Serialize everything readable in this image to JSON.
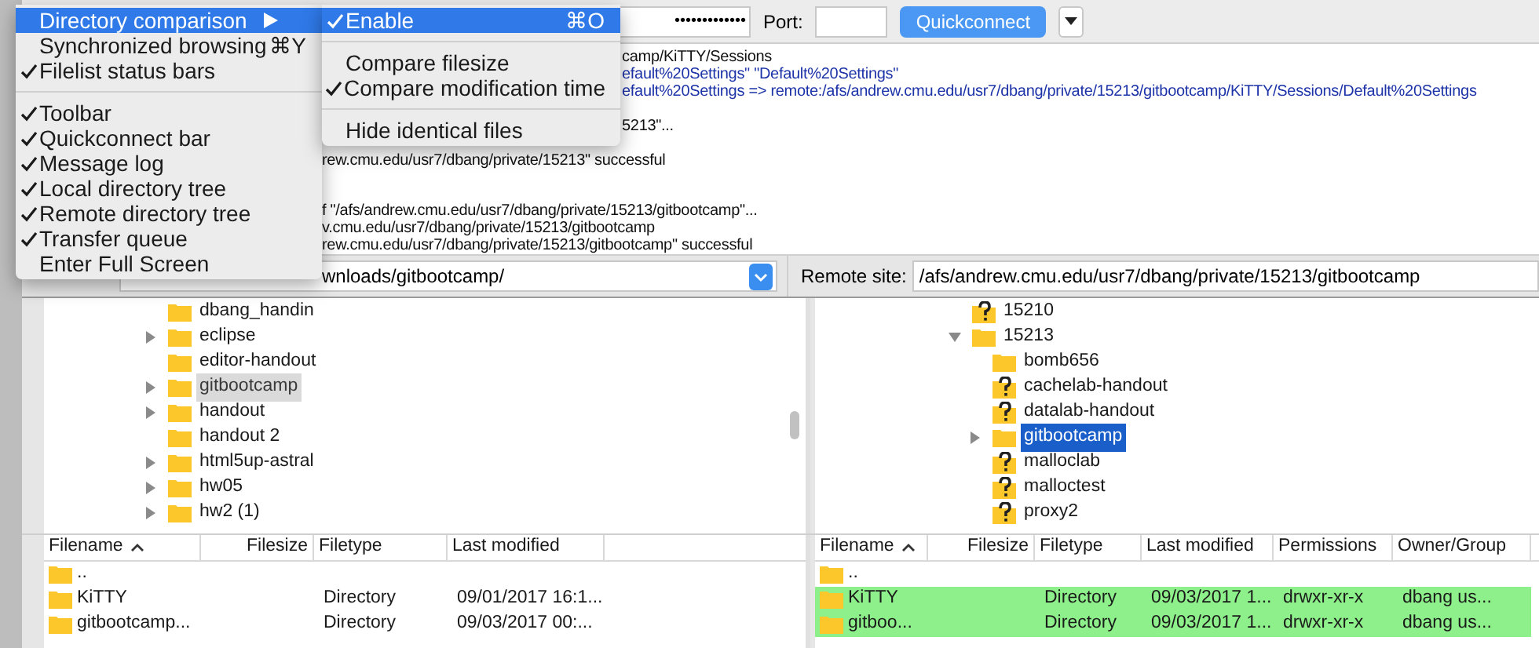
{
  "menu": {
    "items": [
      {
        "kind": "item",
        "label": "Directory comparison",
        "checked": false,
        "selected": true,
        "submenu": true
      },
      {
        "kind": "item",
        "label": "Synchronized browsing",
        "checked": false,
        "selected": false,
        "submenu": false,
        "shortcut": "⌘Y"
      },
      {
        "kind": "item",
        "label": "Filelist status bars",
        "checked": true,
        "selected": false,
        "submenu": false
      },
      {
        "kind": "separator"
      },
      {
        "kind": "item",
        "label": "Toolbar",
        "checked": true,
        "selected": false,
        "submenu": false
      },
      {
        "kind": "item",
        "label": "Quickconnect bar",
        "checked": true,
        "selected": false,
        "submenu": false
      },
      {
        "kind": "item",
        "label": "Message log",
        "checked": true,
        "selected": false,
        "submenu": false
      },
      {
        "kind": "item",
        "label": "Local directory tree",
        "checked": true,
        "selected": false,
        "submenu": false
      },
      {
        "kind": "item",
        "label": "Remote directory tree",
        "checked": true,
        "selected": false,
        "submenu": false
      },
      {
        "kind": "item",
        "label": "Transfer queue",
        "checked": true,
        "selected": false,
        "submenu": false
      },
      {
        "kind": "item",
        "label": "Enter Full Screen",
        "checked": false,
        "selected": false,
        "submenu": false
      }
    ]
  },
  "submenu": {
    "items": [
      {
        "kind": "item",
        "label": "Enable",
        "checked": true,
        "selected": true,
        "shortcut": "⌘O"
      },
      {
        "kind": "separator"
      },
      {
        "kind": "item",
        "label": "Compare filesize",
        "checked": false,
        "selected": false
      },
      {
        "kind": "item",
        "label": "Compare modification time",
        "checked": true,
        "selected": false
      },
      {
        "kind": "separator"
      },
      {
        "kind": "item",
        "label": "Hide identical files",
        "checked": false,
        "selected": false
      }
    ]
  },
  "quickconnect": {
    "password": "•••••••••••••",
    "port_label": "Port:",
    "button": "Quickconnect"
  },
  "message_log": [
    {
      "color": "#111111",
      "text": "camp/KiTTY/Sessions"
    },
    {
      "color": "#1d33a8",
      "text": "efault%20Settings\" \"Default%20Settings\""
    },
    {
      "color": "#1d33a8",
      "text": "efault%20Settings => remote:/afs/andrew.cmu.edu/usr7/dbang/private/15213/gitbootcamp/KiTTY/Sessions/Default%20Settings"
    },
    {
      "color": "#111111",
      "text": "5213\"..."
    },
    {
      "color": "#111111",
      "text": "rew.cmu.edu/usr7/dbang/private/15213\" successful"
    },
    {
      "color": "#111111",
      "text": "f \"/afs/andrew.cmu.edu/usr7/dbang/private/15213/gitbootcamp\"..."
    },
    {
      "color": "#111111",
      "text": "v.cmu.edu/usr7/dbang/private/15213/gitbootcamp"
    },
    {
      "color": "#111111",
      "text": "rew.cmu.edu/usr7/dbang/private/15213/gitbootcamp\" successful"
    }
  ],
  "local_site": {
    "path": "wnloads/gitbootcamp/"
  },
  "remote_site": {
    "label": "Remote site:",
    "path": "/afs/andrew.cmu.edu/usr7/dbang/private/15213/gitbootcamp"
  },
  "local_tree": [
    {
      "name": "dbang_handin",
      "kind": "folder",
      "expandable": false,
      "selected": false
    },
    {
      "name": "eclipse",
      "kind": "folder",
      "expandable": true,
      "selected": false
    },
    {
      "name": "editor-handout",
      "kind": "folder",
      "expandable": false,
      "selected": false
    },
    {
      "name": "gitbootcamp",
      "kind": "folder",
      "expandable": true,
      "selected": true
    },
    {
      "name": "handout",
      "kind": "folder",
      "expandable": true,
      "selected": false
    },
    {
      "name": "handout 2",
      "kind": "folder",
      "expandable": false,
      "selected": false
    },
    {
      "name": "html5up-astral",
      "kind": "folder",
      "expandable": true,
      "selected": false
    },
    {
      "name": "hw05",
      "kind": "folder",
      "expandable": true,
      "selected": false
    },
    {
      "name": "hw2 (1)",
      "kind": "folder",
      "expandable": true,
      "selected": false
    }
  ],
  "remote_tree": [
    {
      "name": "15210",
      "kind": "unknown",
      "expandable": false,
      "selected": false
    },
    {
      "name": "15213",
      "kind": "folder",
      "expandable": true,
      "expanded": true,
      "selected": false,
      "children": [
        {
          "name": "bomb656",
          "kind": "folder",
          "expandable": false,
          "selected": false
        },
        {
          "name": "cachelab-handout",
          "kind": "unknown",
          "expandable": false,
          "selected": false
        },
        {
          "name": "datalab-handout",
          "kind": "unknown",
          "expandable": false,
          "selected": false
        },
        {
          "name": "gitbootcamp",
          "kind": "folder",
          "expandable": true,
          "expanded": false,
          "selected": true
        },
        {
          "name": "malloclab",
          "kind": "unknown",
          "expandable": false,
          "selected": false
        },
        {
          "name": "malloctest",
          "kind": "unknown",
          "expandable": false,
          "selected": false
        },
        {
          "name": "proxy2",
          "kind": "unknown",
          "expandable": false,
          "selected": false
        }
      ]
    }
  ],
  "local_files": {
    "columns": [
      {
        "label": "Filename",
        "sorted": true
      },
      {
        "label": "Filesize",
        "sorted": false
      },
      {
        "label": "Filetype",
        "sorted": false
      },
      {
        "label": "Last modified",
        "sorted": false
      }
    ],
    "rows": [
      {
        "name": "..",
        "changed": false
      },
      {
        "name": "KiTTY",
        "filetype": "Directory",
        "modified": "09/01/2017 16:1...",
        "changed": false
      },
      {
        "name": "gitbootcamp...",
        "filetype": "Directory",
        "modified": "09/03/2017 00:...",
        "changed": false
      }
    ]
  },
  "remote_files": {
    "columns": [
      {
        "label": "Filename",
        "sorted": true
      },
      {
        "label": "Filesize",
        "sorted": false
      },
      {
        "label": "Filetype",
        "sorted": false
      },
      {
        "label": "Last modified",
        "sorted": false
      },
      {
        "label": "Permissions",
        "sorted": false
      },
      {
        "label": "Owner/Group",
        "sorted": false
      }
    ],
    "rows": [
      {
        "name": "..",
        "changed": false
      },
      {
        "name": "KiTTY",
        "filetype": "Directory",
        "modified": "09/03/2017 1...",
        "permissions": "drwxr-xr-x",
        "owner": "dbang us...",
        "changed": true
      },
      {
        "name": "gitboo...",
        "filetype": "Directory",
        "modified": "09/03/2017 1...",
        "permissions": "drwxr-xr-x",
        "owner": "dbang us...",
        "changed": true
      }
    ]
  }
}
